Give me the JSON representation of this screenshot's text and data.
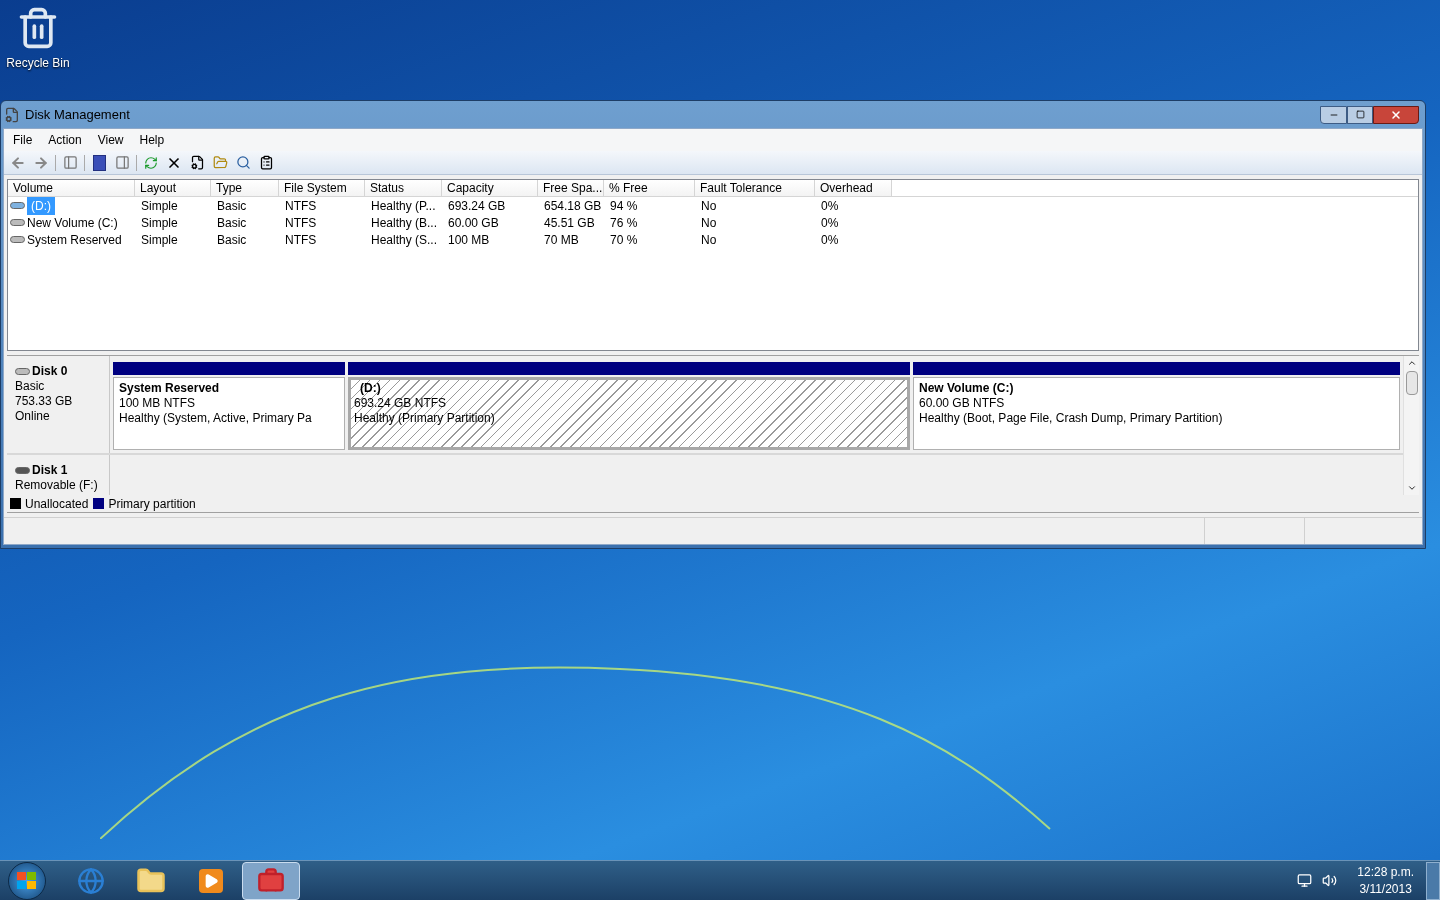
{
  "desktop_icons": [
    {
      "label": "Recycle Bin"
    }
  ],
  "window": {
    "title": "Disk Management",
    "menu": [
      "File",
      "Action",
      "View",
      "Help"
    ],
    "volume_table": {
      "columns": [
        "Volume",
        "Layout",
        "Type",
        "File System",
        "Status",
        "Capacity",
        "Free Spa...",
        "% Free",
        "Fault Tolerance",
        "Overhead"
      ],
      "rows": [
        {
          "selected": true,
          "cells": [
            "(D:)",
            "Simple",
            "Basic",
            "NTFS",
            "Healthy (P...",
            "693.24 GB",
            "654.18 GB",
            "94 %",
            "No",
            "0%"
          ]
        },
        {
          "selected": false,
          "cells": [
            "New Volume (C:)",
            "Simple",
            "Basic",
            "NTFS",
            "Healthy (B...",
            "60.00 GB",
            "45.51 GB",
            "76 %",
            "No",
            "0%"
          ]
        },
        {
          "selected": false,
          "cells": [
            "System Reserved",
            "Simple",
            "Basic",
            "NTFS",
            "Healthy (S...",
            "100 MB",
            "70 MB",
            "70 %",
            "No",
            "0%"
          ]
        }
      ]
    },
    "disks": [
      {
        "name": "Disk 0",
        "kind": "hdd",
        "lines": [
          "Basic",
          "753.33 GB",
          "Online"
        ],
        "partitions": [
          {
            "title": "System Reserved",
            "size": "100 MB NTFS",
            "status": "Healthy (System, Active, Primary Pa",
            "selected": false
          },
          {
            "title": "(D:)",
            "size": "693.24 GB NTFS",
            "status": "Healthy (Primary Partition)",
            "selected": true
          },
          {
            "title": "New Volume  (C:)",
            "size": "60.00 GB NTFS",
            "status": "Healthy (Boot, Page File, Crash Dump, Primary Partition)",
            "selected": false
          }
        ]
      },
      {
        "name": "Disk 1",
        "kind": "removable",
        "lines": [
          "Removable (F:)"
        ]
      }
    ],
    "legend": [
      {
        "label": "Unallocated",
        "color": "#000000"
      },
      {
        "label": "Primary partition",
        "color": "#000080"
      }
    ]
  },
  "taskbar": {
    "items": [
      {
        "kind": "browser",
        "selected": false
      },
      {
        "kind": "folder",
        "selected": false
      },
      {
        "kind": "media",
        "selected": false
      },
      {
        "kind": "toolbox",
        "selected": true
      }
    ],
    "clock": {
      "time": "12:28 p.m.",
      "date": "3/11/2013"
    }
  }
}
